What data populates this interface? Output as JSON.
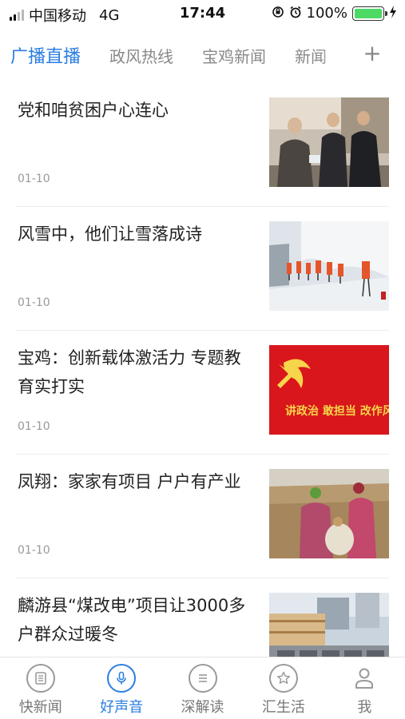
{
  "status_bar": {
    "carrier": "中国移动",
    "network": "4G",
    "time": "17:44",
    "battery_percent": "100%"
  },
  "top_tabs": {
    "items": [
      {
        "label": "广播直播",
        "active": true
      },
      {
        "label": "政风热线",
        "active": false
      },
      {
        "label": "宝鸡新闻",
        "active": false
      },
      {
        "label": "新闻",
        "active": false
      }
    ],
    "add_label": "+"
  },
  "news": [
    {
      "title": "党和咱贫困户心连心",
      "date": "01-10",
      "thumb": "people-greeting-photo"
    },
    {
      "title": "风雪中，他们让雪落成诗",
      "date": "01-10",
      "thumb": "snow-workers-photo"
    },
    {
      "title": "宝鸡：创新载体激活力 专题教育实打实",
      "date": "01-10",
      "thumb": "party-banner-photo",
      "banner_text": "讲政治 敢担当 改作风"
    },
    {
      "title": "凤翔：家家有项目 户户有产业",
      "date": "01-10",
      "thumb": "farmers-field-photo"
    },
    {
      "title": "麟游县“煤改电”项目让3000多户群众过暖冬",
      "date": "",
      "thumb": "building-units-photo"
    }
  ],
  "bottom_nav": {
    "items": [
      {
        "label": "快新闻",
        "icon": "news-icon",
        "active": false
      },
      {
        "label": "好声音",
        "icon": "microphone-icon",
        "active": true
      },
      {
        "label": "深解读",
        "icon": "list-icon",
        "active": false
      },
      {
        "label": "汇生活",
        "icon": "star-icon",
        "active": false
      },
      {
        "label": "我",
        "icon": "person-icon",
        "active": false
      }
    ]
  },
  "colors": {
    "accent": "#2a7de1",
    "inactive": "#888888",
    "battery": "#4cd964",
    "party_red": "#d8161b",
    "party_yellow": "#f7d54a"
  }
}
